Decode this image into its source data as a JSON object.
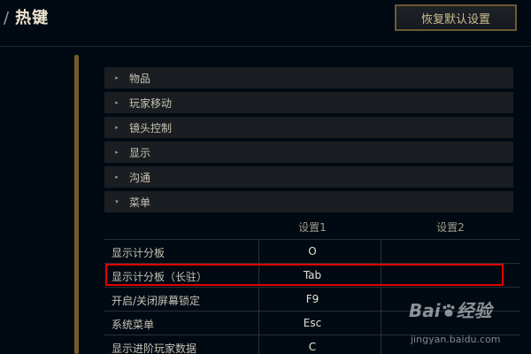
{
  "header": {
    "separator": "/",
    "title": "热键",
    "restore_label": "恢复默认设置"
  },
  "categories": [
    {
      "label": "物品",
      "state": "collapsed",
      "arrow": "▸"
    },
    {
      "label": "玩家移动",
      "state": "collapsed",
      "arrow": "▸"
    },
    {
      "label": "镜头控制",
      "state": "collapsed",
      "arrow": "▸"
    },
    {
      "label": "显示",
      "state": "collapsed",
      "arrow": "▸"
    },
    {
      "label": "沟通",
      "state": "collapsed",
      "arrow": "▸"
    },
    {
      "label": "菜单",
      "state": "expanded",
      "arrow": "▾"
    }
  ],
  "table": {
    "columns": [
      "设置1",
      "设置2"
    ],
    "rows": [
      {
        "name": "显示计分板",
        "key1": "O",
        "key2": ""
      },
      {
        "name": "显示计分板（长驻）",
        "key1": "Tab",
        "key2": ""
      },
      {
        "name": "开启/关闭屏幕锁定",
        "key1": "F9",
        "key2": ""
      },
      {
        "name": "系统菜单",
        "key1": "Esc",
        "key2": ""
      },
      {
        "name": "显示进阶玩家数据",
        "key1": "C",
        "key2": ""
      }
    ]
  },
  "watermark": {
    "brand": "Bai",
    "brand_tail": "经验",
    "url": "jingyan.baidu.com"
  },
  "colors": {
    "background": "#010a13",
    "accent_gold": "#785a28",
    "highlight_red": "#e00000"
  }
}
